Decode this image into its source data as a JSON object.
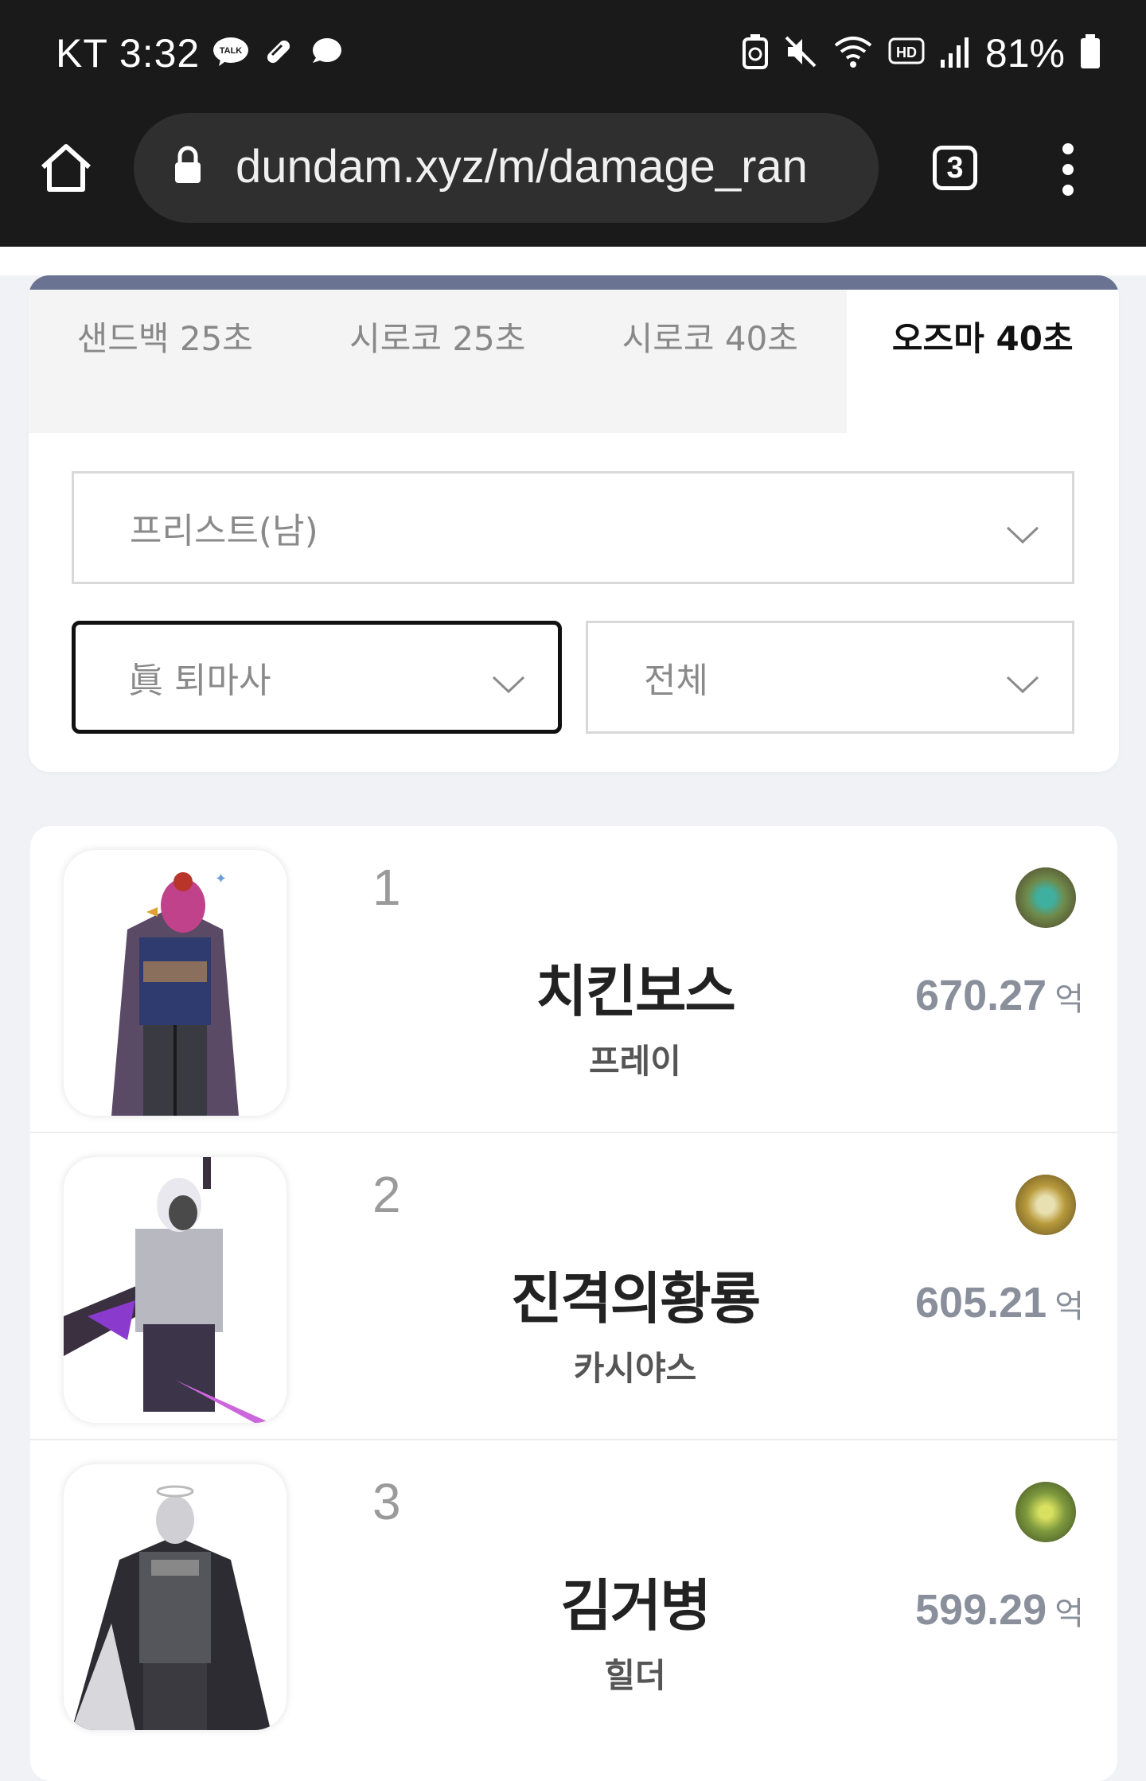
{
  "status_bar": {
    "carrier_time": "KT 3:32",
    "talk_badge": "TALK",
    "battery_pct": "81%",
    "hd_badge": "HD",
    "icons": [
      "kakaotalk-icon",
      "pill-icon",
      "chat-bubble-icon",
      "battery-saver-icon",
      "mute-icon",
      "wifi-icon",
      "hd-icon",
      "signal-icon",
      "battery-icon"
    ]
  },
  "browser": {
    "url": "dundam.xyz/m/damage_ran",
    "tab_count": "3"
  },
  "tabs": [
    {
      "label": "샌드백 25초",
      "active": false
    },
    {
      "label": "시로코 25초",
      "active": false
    },
    {
      "label": "시로코 40초",
      "active": false
    },
    {
      "label": "오즈마 40초",
      "active": true
    }
  ],
  "filters": {
    "class_select": "프리스트(남)",
    "skill_select": "眞 퇴마사",
    "scope_select": "전체"
  },
  "ranking": [
    {
      "rank": "1",
      "name": "치킨보스",
      "server": "프레이",
      "damage": "670.27",
      "unit": "억",
      "medal_color": "#6f8a4a"
    },
    {
      "rank": "2",
      "name": "진격의황룡",
      "server": "카시야스",
      "damage": "605.21",
      "unit": "억",
      "medal_color": "#b89a3c"
    },
    {
      "rank": "3",
      "name": "김거병",
      "server": "힐더",
      "damage": "599.29",
      "unit": "억",
      "medal_color": "#7e9a3e"
    }
  ],
  "colors": {
    "accent_bar": "#6b7392",
    "damage_text": "#8a8f9c"
  }
}
